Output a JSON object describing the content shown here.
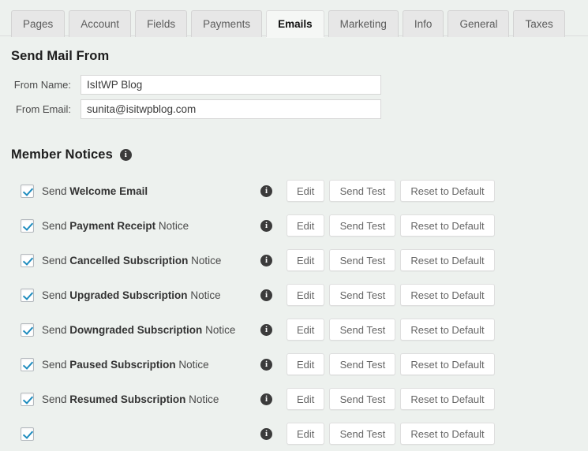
{
  "tabs": [
    {
      "label": "Pages",
      "active": false
    },
    {
      "label": "Account",
      "active": false
    },
    {
      "label": "Fields",
      "active": false
    },
    {
      "label": "Payments",
      "active": false
    },
    {
      "label": "Emails",
      "active": true
    },
    {
      "label": "Marketing",
      "active": false
    },
    {
      "label": "Info",
      "active": false
    },
    {
      "label": "General",
      "active": false
    },
    {
      "label": "Taxes",
      "active": false
    }
  ],
  "send_mail_from": {
    "heading": "Send Mail From",
    "fields": [
      {
        "label": "From Name:",
        "value": "IsItWP Blog",
        "placeholder": ""
      },
      {
        "label": "From Email:",
        "value": "sunita@isitwpblog.com",
        "placeholder": ""
      }
    ]
  },
  "member_notices": {
    "heading": "Member Notices",
    "info_icon": "info-icon",
    "buttons": {
      "edit": "Edit",
      "send_test": "Send Test",
      "reset": "Reset to Default"
    },
    "rows": [
      {
        "checked": true,
        "prefix": "Send",
        "strong": "Welcome Email",
        "suffix": ""
      },
      {
        "checked": true,
        "prefix": "Send",
        "strong": "Payment Receipt",
        "suffix": "Notice"
      },
      {
        "checked": true,
        "prefix": "Send",
        "strong": "Cancelled Subscription",
        "suffix": "Notice"
      },
      {
        "checked": true,
        "prefix": "Send",
        "strong": "Upgraded Subscription",
        "suffix": "Notice"
      },
      {
        "checked": true,
        "prefix": "Send",
        "strong": "Downgraded Subscription",
        "suffix": "Notice"
      },
      {
        "checked": true,
        "prefix": "Send",
        "strong": "Paused Subscription",
        "suffix": "Notice"
      },
      {
        "checked": true,
        "prefix": "Send",
        "strong": "Resumed Subscription",
        "suffix": "Notice"
      },
      {
        "checked": true,
        "prefix": "",
        "strong": "",
        "suffix": ""
      }
    ]
  },
  "colors": {
    "background": "#edf1ee",
    "active_tab": "#f5f7f5",
    "inactive_tab": "#e7e7e7",
    "checkbox_check": "#1e8cbe",
    "info_icon": "#3b3b3b"
  }
}
